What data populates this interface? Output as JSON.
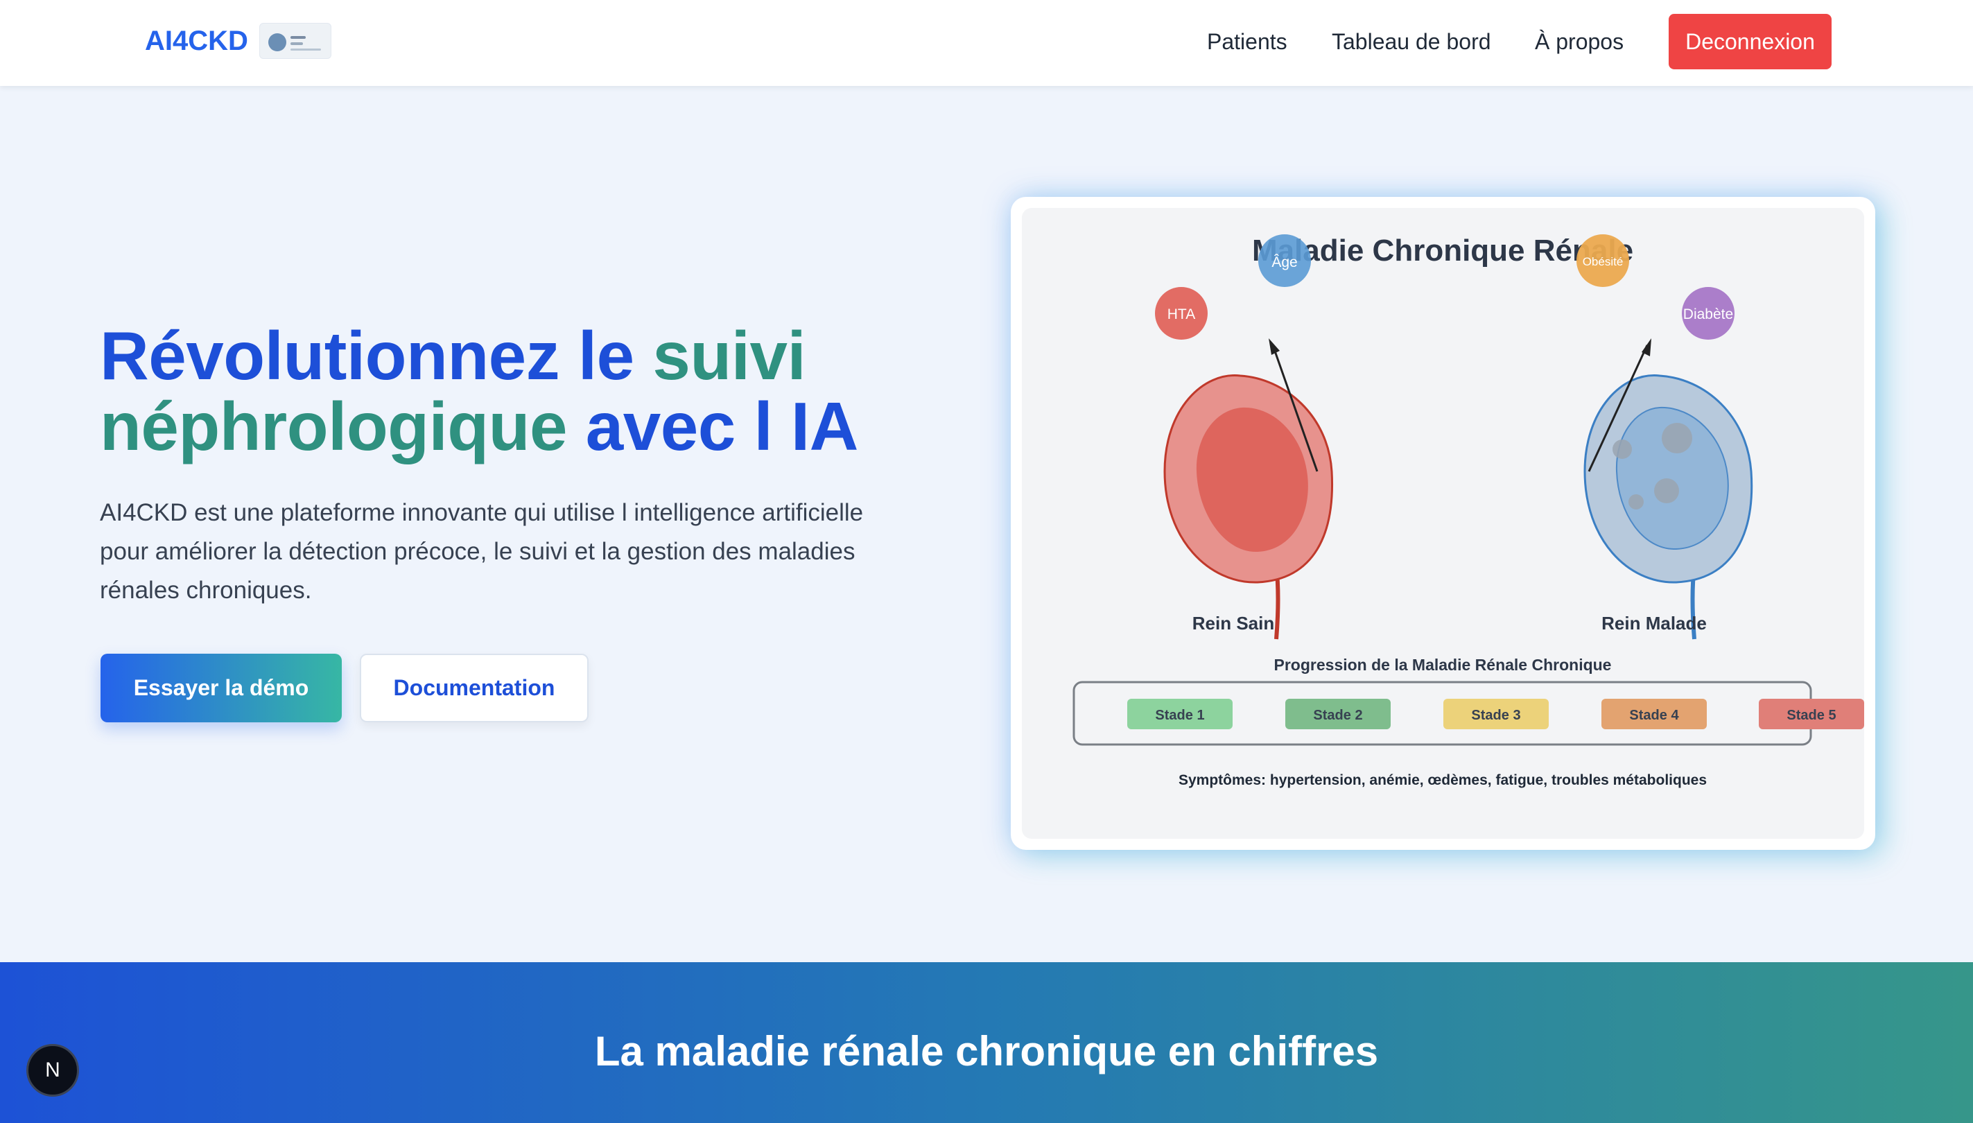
{
  "navbar": {
    "brand": "AI4CKD",
    "links": [
      "Patients",
      "Tableau de bord",
      "À propos"
    ],
    "logout_label": "Deconnexion",
    "logout_color": "#ef4444"
  },
  "hero": {
    "title_part1": "Révolutionnez le ",
    "title_part2": "suivi néphrologique",
    "title_part3": " avec l IA",
    "description": "AI4CKD est une plateforme innovante qui utilise l intelligence artificielle pour améliorer la détection précoce, le suivi et la gestion des maladies rénales chroniques.",
    "primary_button": "Essayer la démo",
    "secondary_button": "Documentation"
  },
  "illustration": {
    "title": "Maladie Chronique Rénale",
    "risk_factors": [
      {
        "label": "Âge",
        "color": "#5b9bd5"
      },
      {
        "label": "HTA",
        "color": "#e0645c"
      },
      {
        "label": "Obésité",
        "color": "#eba94f"
      },
      {
        "label": "Diabète",
        "color": "#a777c7"
      }
    ],
    "healthy_label": "Rein Sain",
    "sick_label": "Rein Malade",
    "progression_title": "Progression de la Maladie Rénale Chronique",
    "stages": [
      {
        "label": "Stade 1",
        "color": "#8dd39e"
      },
      {
        "label": "Stade 2",
        "color": "#7fbd8d"
      },
      {
        "label": "Stade 3",
        "color": "#ecd27a"
      },
      {
        "label": "Stade 4",
        "color": "#e3a370"
      },
      {
        "label": "Stade 5",
        "color": "#e07f78"
      }
    ],
    "symptoms": "Symptômes: hypertension, anémie, œdèmes, fatigue, troubles métaboliques"
  },
  "stats": {
    "title": "La maladie rénale chronique en chiffres"
  },
  "dev_badge": "N"
}
